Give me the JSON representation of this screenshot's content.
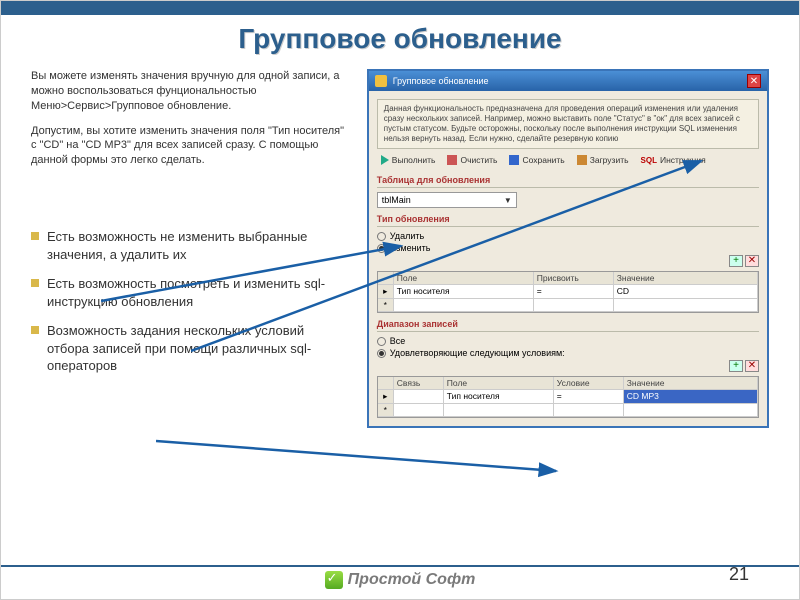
{
  "title": "Групповое обновление",
  "intro1": "Вы можете изменять значения вручную для одной записи, а можно воспользоваться фунциональностью Меню>Сервис>Групповое обновление.",
  "intro2": "Допустим, вы хотите изменить значения поля \"Тип носителя\" с \"CD\" на \"CD MP3\" для всех записей сразу. С помощью данной формы это легко сделать.",
  "bullets": [
    "Есть возможность не изменить выбранные значения, а удалить их",
    "Есть возможность посмотреть и изменить sql-инструкцию обновления",
    "Возможность задания нескольких условий отбора записей при помощи различных sql-операторов"
  ],
  "dialog": {
    "title": "Групповое обновление",
    "info": "Данная функциональность предназначена для проведения операций изменения или удаления сразу нескольких записей. Например, можно выставить поле \"Статус\" в \"ок\" для всех записей с пустым статусом. Будьте осторожны, поскольку после выполнения инструкции SQL изменения нельзя вернуть назад. Если нужно, сделайте резервную копию",
    "toolbar": {
      "run": "Выполнить",
      "clear": "Очистить",
      "save": "Сохранить",
      "load": "Загрузить",
      "sql": "SQL",
      "instr": "Инструкция"
    },
    "sec_table": "Таблица для обновления",
    "table_value": "tblMain",
    "sec_type": "Тип обновления",
    "radio_delete": "Удалить",
    "radio_change": "Изменить",
    "grid1": {
      "h1": "Поле",
      "h2": "Присвоить",
      "h3": "Значение",
      "r1c1": "Тип носителя",
      "r1c2": "=",
      "r1c3": "CD"
    },
    "sec_range": "Диапазон записей",
    "radio_all": "Все",
    "radio_cond": "Удовлетворяющие следующим условиям:",
    "grid2": {
      "h0": "Связь",
      "h1": "Поле",
      "h2": "Условие",
      "h3": "Значение",
      "r1c1": "Тип носителя",
      "r1c2": "=",
      "r1c3": "CD MP3"
    }
  },
  "brand": "Простой Софт",
  "page": "21"
}
